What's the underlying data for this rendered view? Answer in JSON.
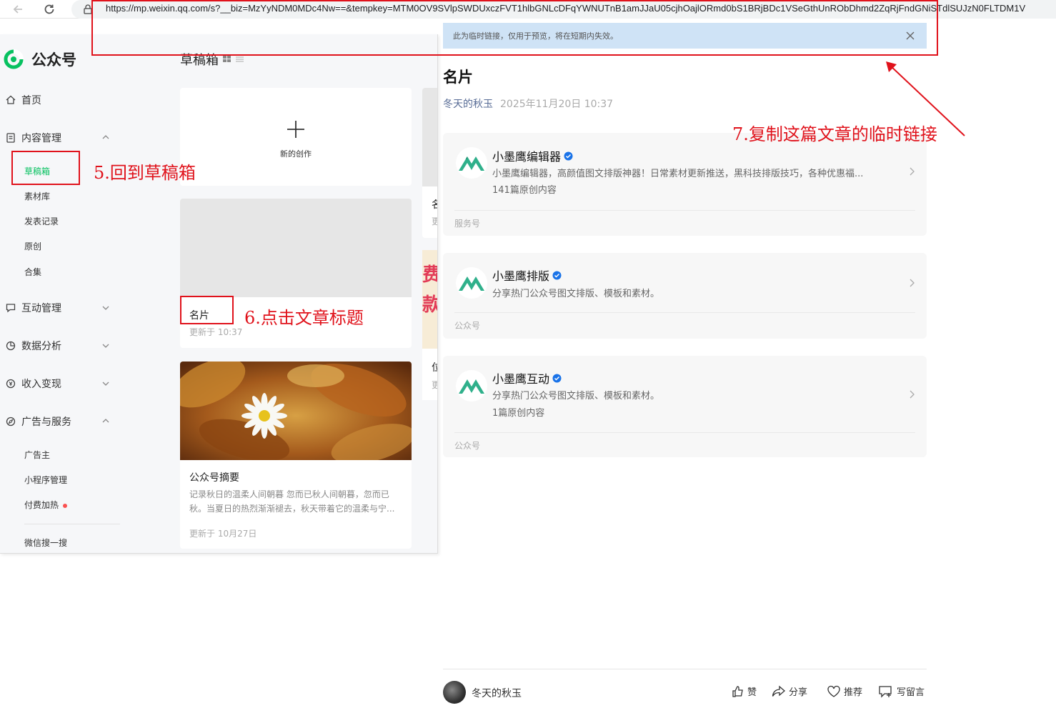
{
  "browser": {
    "url": "https://mp.weixin.qq.com/s?__biz=MzYyNDM0MDc4Nw==&tempkey=MTM0OV9SVlpSWDUxczFVT1hlbGNLcDFqYWNUTnB1amJJaU05cjhOajlORmd0bS1BRjBDc1VSeGthUnRObDhmd2ZqRjFndGNiSTdlSUJzN0FLTDM1V"
  },
  "backend": {
    "logo_text": "公众号",
    "nav": {
      "home": "首页",
      "content_mgmt": "内容管理",
      "drafts": "草稿箱",
      "materials": "素材库",
      "publish_log": "发表记录",
      "original": "原创",
      "collection": "合集",
      "interaction": "互动管理",
      "analytics": "数据分析",
      "monetize": "收入变现",
      "ads": "广告与服务",
      "advertiser": "广告主",
      "miniprogram": "小程序管理",
      "paid_boost": "付费加热",
      "wechat_search": "微信搜一搜"
    },
    "drafts_title": "草稿箱",
    "new_creation": "新的创作",
    "card1": {
      "title": "名片",
      "time": "更新于 10:37"
    },
    "card2": {
      "title": "公众号摘要",
      "desc": "记录秋日的温柔人间朝暮 忽而已秋人间朝暮，忽而已秋。当夏日的热烈渐渐褪去，秋天带着它的温柔与宁...",
      "time": "更新于 10月27日"
    },
    "partial_col": {
      "a1": "名",
      "a2": "更",
      "b1": "费",
      "b2": "款",
      "c1": "位",
      "c2": "更"
    }
  },
  "article": {
    "notice": "此为临时链接，仅用于预览，将在短期内失效。",
    "title": "名片",
    "author": "冬天的秋玉",
    "date": "2025年11月20日 10:37",
    "accounts": [
      {
        "name": "小墨鹰编辑器",
        "desc": "小墨鹰编辑器，高颜值图文排版神器！日常素材更新推送，黑科技排版技巧，各种优惠福...",
        "count": "141篇原创内容",
        "type": "服务号"
      },
      {
        "name": "小墨鹰排版",
        "desc": "分享热门公众号图文排版、模板和素材。",
        "count": "",
        "type": "公众号"
      },
      {
        "name": "小墨鹰互动",
        "desc": "分享热门公众号图文排版、模板和素材。",
        "count": "1篇原创内容",
        "type": "公众号"
      }
    ],
    "footer": {
      "author": "冬天的秋玉",
      "like": "赞",
      "share": "分享",
      "recommend": "推荐",
      "comment": "写留言"
    }
  },
  "annotations": {
    "step5": "5.回到草稿箱",
    "step6": "6.点击文章标题",
    "step7": "7.复制这篇文章的临时链接"
  },
  "colors": {
    "accent": "#07c160",
    "annotation": "#e0121b",
    "notice_bg": "#cfe3f6",
    "link": "#576b95"
  }
}
